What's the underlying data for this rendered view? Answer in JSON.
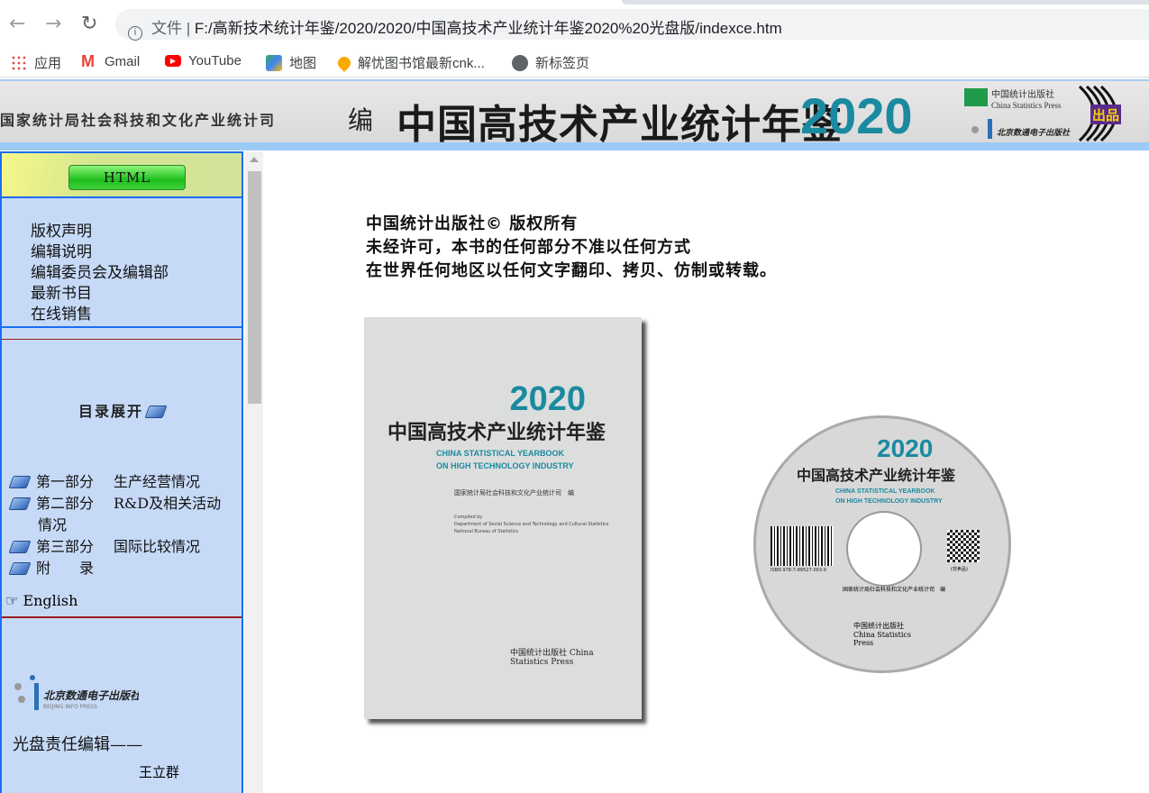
{
  "browser": {
    "url_label": "文件",
    "url": "F:/高新技术统计年鉴/2020/2020/中国高技术产业统计年鉴2020%20光盘版/indexce.htm",
    "bookmarks": [
      {
        "label": "应用",
        "icon": "apps-grid-icon"
      },
      {
        "label": "Gmail",
        "icon": "gmail-icon"
      },
      {
        "label": "YouTube",
        "icon": "youtube-icon"
      },
      {
        "label": "地图",
        "icon": "maps-icon"
      },
      {
        "label": "解忧图书馆最新cnk...",
        "icon": "lightbulb-pin-icon"
      },
      {
        "label": "新标签页",
        "icon": "globe-icon"
      }
    ]
  },
  "banner": {
    "org": "国家统计局社会科技和文化产业统计司",
    "bian": "编",
    "title": "中国高技术产业统计年鉴",
    "year": "2020",
    "publisher_logo": "中国统计出版社 China Statistics Press 北京数通电子出版社 BEIJING INFO PRESS 出品"
  },
  "colors": {
    "accent_blue": "#1a6df5",
    "sidebar_bg": "#c6daf7",
    "teal": "#1b8aa0",
    "divider_red": "#9b1c1c"
  },
  "sidebar": {
    "html_button": "HTML",
    "links": [
      "版权声明",
      "编辑说明",
      "编辑委员会及编辑部",
      "最新书目",
      "在线销售"
    ],
    "toc_title": "目录展开",
    "toc": [
      {
        "part": "第一部分",
        "title": "生产经营情况"
      },
      {
        "part": "第二部分",
        "title": "R&D及相关活动情况"
      },
      {
        "part": "第三部分",
        "title": "国际比较情况"
      },
      {
        "part": "附　　录",
        "title": ""
      }
    ],
    "english": "English",
    "logo": "北京数通电子出版社 BEIJING INFO PRESS",
    "editor_label": "光盘责任编辑——",
    "editor_name": "王立群"
  },
  "main": {
    "copyright": [
      "中国统计出版社© 版权所有",
      "未经许可，本书的任何部分不准以任何方式",
      "在世界任何地区以任何文字翻印、拷贝、仿制或转载。"
    ],
    "cover": {
      "year": "2020",
      "title": "中国高技术产业统计年鉴",
      "en1": "CHINA STATISTICAL YEARBOOK",
      "en2": "ON HIGH TECHNOLOGY INDUSTRY",
      "editor": "国家统计局社会科技和文化产业统计司　编",
      "compiled": "Compiled by",
      "dept": "Department of Social Science and Technology and Cultural Statistics National Bureau of Statistics",
      "press": "中国统计出版社 China Statistics Press"
    },
    "disc": {
      "year": "2020",
      "title": "中国高技术产业统计年鉴",
      "en1": "CHINA STATISTICAL YEARBOOK",
      "en2": "ON HIGH TECHNOLOGY INDUSTRY",
      "isbn": "ISBN 978-7-89527-003-9",
      "not_for_sale": "(非卖品)",
      "editor": "国家统计局社会科技和文化产业统计司　编",
      "press": "中国统计出版社 China Statistics Press"
    }
  }
}
